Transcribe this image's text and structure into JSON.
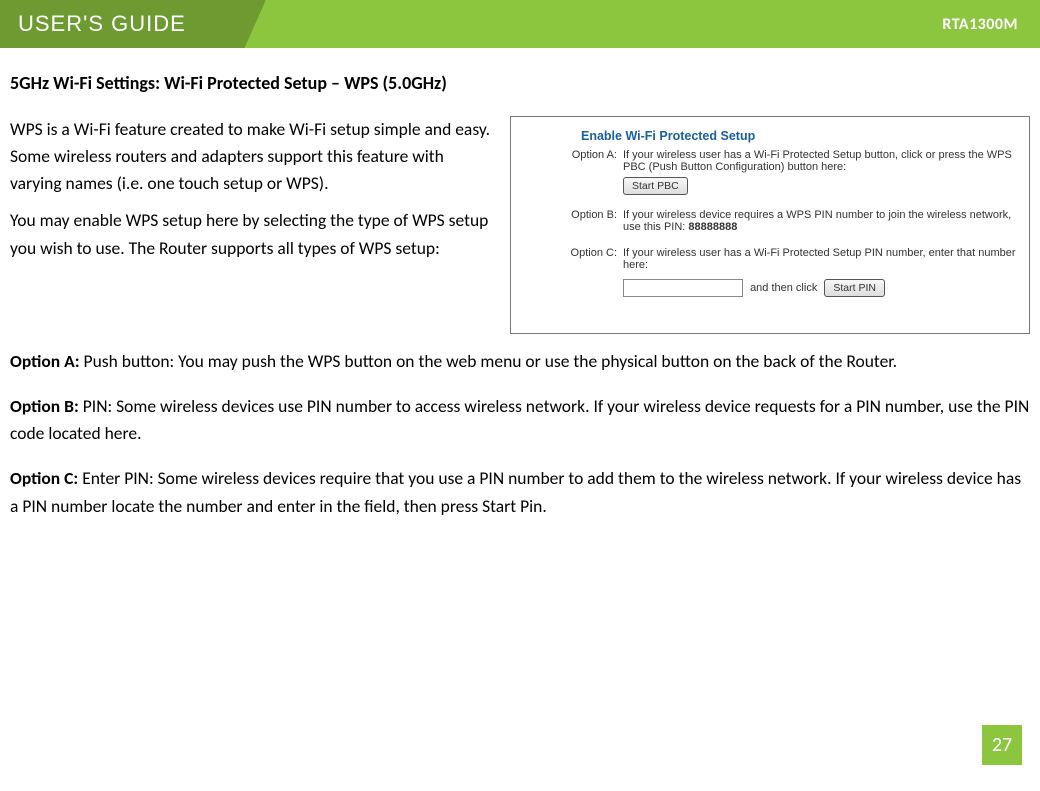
{
  "header": {
    "guide_label": "USER'S GUIDE",
    "model": "RTA1300M"
  },
  "page_title": "5GHz Wi-Fi Settings: Wi-Fi Protected Setup – WPS (5.0GHz)",
  "intro": {
    "p1": "WPS is a Wi-Fi feature created to make Wi-Fi setup simple and easy.  Some wireless routers and adapters support this feature with varying names (i.e. one touch setup or WPS).",
    "p2": "You may enable WPS setup here by selecting the type of WPS setup you wish to use. The Router supports all types of WPS setup:"
  },
  "panel": {
    "title": "Enable Wi-Fi Protected Setup",
    "optA": {
      "label": "Option A:",
      "text": "If your wireless user has a Wi-Fi Protected Setup button, click or press the WPS PBC (Push Button Configuration) button here:",
      "button": "Start PBC"
    },
    "optB": {
      "label": "Option B:",
      "text": "If your wireless device requires a WPS PIN number to join the wireless network, use this PIN:",
      "pin": "88888888"
    },
    "optC": {
      "label": "Option C:",
      "text": "If your wireless user has a Wi-Fi Protected Setup PIN number, enter that number here:",
      "andthen": "and then click",
      "button": "Start PIN"
    }
  },
  "options": {
    "a": {
      "lead": "Option A:",
      "text": " Push button: You may push the WPS button on the web menu or use the physical button on the back of the Router."
    },
    "b": {
      "lead": "Option B:",
      "text": " PIN: Some wireless devices use PIN number to access wireless network.  If your wireless device requests for a PIN number, use the PIN code located here."
    },
    "c": {
      "lead": "Option C:",
      "text": " Enter PIN: Some wireless devices require that you use a PIN number to add them to the wireless network.  If your wireless device has a PIN number locate the number and enter in the field, then press Start Pin."
    }
  },
  "page_number": "27"
}
